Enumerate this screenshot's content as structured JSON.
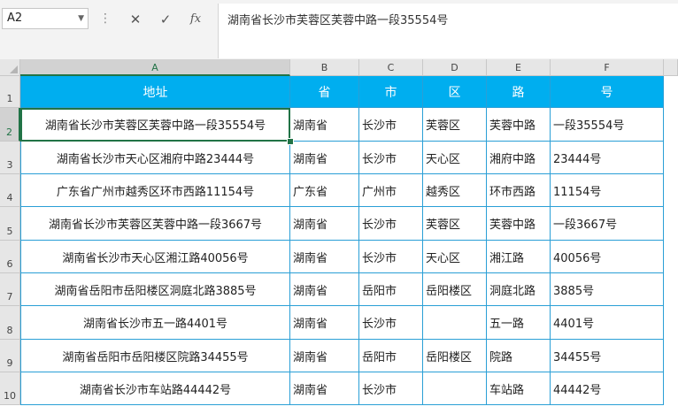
{
  "formula_bar": {
    "name_box": "A2",
    "cancel_icon": "✕",
    "enter_icon": "✓",
    "fx_icon": "fx",
    "formula": "湖南省长沙市芙蓉区芙蓉中路一段35554号"
  },
  "columns": [
    "A",
    "B",
    "C",
    "D",
    "E",
    "F"
  ],
  "rows": [
    "1",
    "2",
    "3",
    "4",
    "5",
    "6",
    "7",
    "8",
    "9",
    "10"
  ],
  "header": [
    "地址",
    "省",
    "市",
    "区",
    "路",
    "号"
  ],
  "data": [
    [
      "湖南省长沙市芙蓉区芙蓉中路一段35554号",
      "湖南省",
      "长沙市",
      "芙蓉区",
      "芙蓉中路",
      "一段35554号"
    ],
    [
      "湖南省长沙市天心区湘府中路23444号",
      "湖南省",
      "长沙市",
      "天心区",
      "湘府中路",
      "23444号"
    ],
    [
      "广东省广州市越秀区环市西路11154号",
      "广东省",
      "广州市",
      "越秀区",
      "环市西路",
      "11154号"
    ],
    [
      "湖南省长沙市芙蓉区芙蓉中路一段3667号",
      "湖南省",
      "长沙市",
      "芙蓉区",
      "芙蓉中路",
      "一段3667号"
    ],
    [
      "湖南省长沙市天心区湘江路40056号",
      "湖南省",
      "长沙市",
      "天心区",
      "湘江路",
      "40056号"
    ],
    [
      "湖南省岳阳市岳阳楼区洞庭北路3885号",
      "湖南省",
      "岳阳市",
      "岳阳楼区",
      "洞庭北路",
      "3885号"
    ],
    [
      "湖南省长沙市五一路4401号",
      "湖南省",
      "长沙市",
      "",
      "五一路",
      "4401号"
    ],
    [
      "湖南省岳阳市岳阳楼区院路34455号",
      "湖南省",
      "岳阳市",
      "岳阳楼区",
      "院路",
      "34455号"
    ],
    [
      "湖南省长沙市车站路44442号",
      "湖南省",
      "长沙市",
      "",
      "车站路",
      "44442号"
    ]
  ],
  "colors": {
    "header_fill": "#00aeef",
    "border": "#2a9fd6",
    "selection": "#217346"
  }
}
